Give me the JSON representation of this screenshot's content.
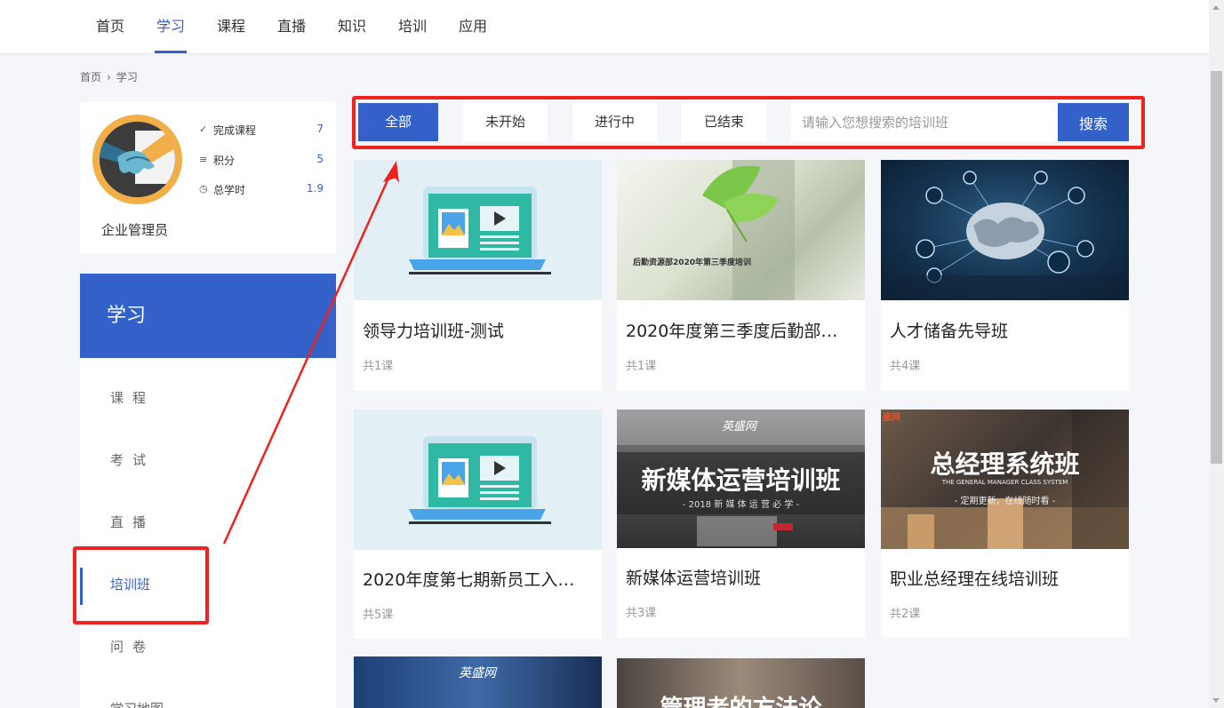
{
  "nav": {
    "items": [
      {
        "label": "首页",
        "active": false
      },
      {
        "label": "学习",
        "active": true
      },
      {
        "label": "课程",
        "active": false
      },
      {
        "label": "直播",
        "active": false
      },
      {
        "label": "知识",
        "active": false
      },
      {
        "label": "培训",
        "active": false
      },
      {
        "label": "应用",
        "active": false
      }
    ]
  },
  "breadcrumb": {
    "home": "首页",
    "separator": "›",
    "current": "学习"
  },
  "profile": {
    "username": "企业管理员",
    "stats": [
      {
        "label": "完成课程",
        "value": "7",
        "icon": "check-list-icon"
      },
      {
        "label": "积分",
        "value": "5",
        "icon": "coins-icon"
      },
      {
        "label": "总学时",
        "value": "1.9",
        "icon": "clock-icon"
      }
    ]
  },
  "sidebar": {
    "heading": "学习",
    "items": [
      {
        "label": "课程",
        "active": false
      },
      {
        "label": "考试",
        "active": false
      },
      {
        "label": "直播",
        "active": false
      },
      {
        "label": "培训班",
        "active": true
      },
      {
        "label": "问卷",
        "active": false
      },
      {
        "label": "学习地图",
        "active": false
      }
    ]
  },
  "filter": {
    "tabs": [
      {
        "label": "全部",
        "active": true
      },
      {
        "label": "未开始",
        "active": false
      },
      {
        "label": "进行中",
        "active": false
      },
      {
        "label": "已结束",
        "active": false
      }
    ],
    "search_placeholder": "请输入您想搜索的培训班",
    "search_button": "搜索"
  },
  "cards": [
    {
      "title": "领导力培训班-测试",
      "count": "共1课",
      "image": "laptop-illustration"
    },
    {
      "title": "2020年度第三季度后勤部…",
      "count": "共1课",
      "image": "ginkgo-photo",
      "image_text": "后勤资源部2020年第三季度培训"
    },
    {
      "title": "人才储备先导班",
      "count": "共4课",
      "image": "brain-network-photo"
    },
    {
      "title": "2020年度第七期新员工入…",
      "count": "共5课",
      "image": "laptop-illustration"
    },
    {
      "title": "新媒体运营培训班",
      "count": "共3课",
      "image": "new-media-banner",
      "image_text": "新媒体运营培训班",
      "image_sub": "- 2018 新 媒 体 运 营 必 学 -",
      "image_logo": "英盛网"
    },
    {
      "title": "职业总经理在线培训班",
      "count": "共2课",
      "image": "gm-banner",
      "image_text": "总经理系统班",
      "image_sub": "THE GENERAL MANAGER CLASS SYSTEM",
      "image_sub2": "- 定期更新，在线随时看 -",
      "image_logo": "盛网"
    },
    {
      "title": "",
      "count": "",
      "image": "partial-banner-1",
      "image_logo": "英盛网"
    },
    {
      "title": "",
      "count": "",
      "image": "partial-banner-2",
      "image_text": "管理者的方法论"
    }
  ],
  "colors": {
    "accent": "#3461c9",
    "annotation": "#f0221f",
    "background": "#f4f6f9"
  }
}
